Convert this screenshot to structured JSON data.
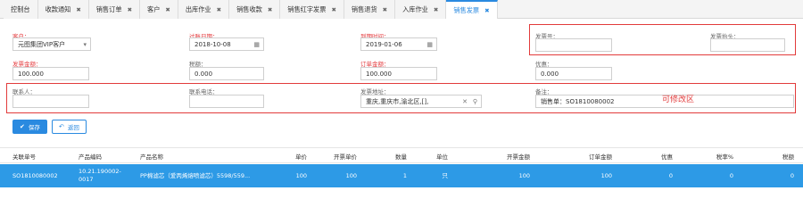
{
  "tabs": [
    {
      "label": "控制台",
      "closable": false
    },
    {
      "label": "收款通知",
      "closable": true
    },
    {
      "label": "销售订单",
      "closable": true
    },
    {
      "label": "客户",
      "closable": true
    },
    {
      "label": "出库作业",
      "closable": true
    },
    {
      "label": "销售收款",
      "closable": true
    },
    {
      "label": "销售红字发票",
      "closable": true
    },
    {
      "label": "销售退货",
      "closable": true
    },
    {
      "label": "入库作业",
      "closable": true
    },
    {
      "label": "销售发票",
      "closable": true,
      "active": true
    }
  ],
  "close_glyph": "✖",
  "form": {
    "customer": {
      "label": "客户：",
      "value": "元图集团VIP客户"
    },
    "start_date": {
      "label": "过账日期：",
      "value": "2018-10-08"
    },
    "end_date": {
      "label": "到期时间：",
      "value": "2019-01-06"
    },
    "invoice_no": {
      "label": "发票号：",
      "value": ""
    },
    "invoice_title": {
      "label": "发票抬头：",
      "value": ""
    },
    "invoice_amount": {
      "label": "发票金额：",
      "value": "100.000"
    },
    "tax_amount": {
      "label": "税额：",
      "value": "0.000"
    },
    "order_amount": {
      "label": "订单金额：",
      "value": "100.000"
    },
    "discount": {
      "label": "优惠：",
      "value": "0.000"
    },
    "contact": {
      "label": "联系人：",
      "value": ""
    },
    "contact_phone": {
      "label": "联系电话：",
      "value": ""
    },
    "invoice_address": {
      "label": "发票地址：",
      "value": "重庆,重庆市,渝北区,[],"
    },
    "remark": {
      "label": "备注：",
      "value": "销售单：SO1810080002"
    }
  },
  "annotation": "可修改区",
  "buttons": {
    "save": "保存",
    "back": "返回"
  },
  "table": {
    "headers": [
      "关联单号",
      "产品编码",
      "产品名称",
      "单价",
      "开票单价",
      "数量",
      "单位",
      "开票金额",
      "订单金额",
      "优惠",
      "税率%",
      "税额"
    ],
    "rows": [
      [
        "SO1810080002",
        "10.21.190002-0017",
        "PP棉滤芯（爱丙烯熔喷滤芯）5598/559...",
        "100",
        "100",
        "1",
        "只",
        "100",
        "100",
        "0",
        "0",
        "0"
      ]
    ]
  },
  "colors": {
    "accent": "#2a8ae0",
    "highlight_row": "#2d9ae6",
    "annotation_red": "#e23b3b"
  }
}
